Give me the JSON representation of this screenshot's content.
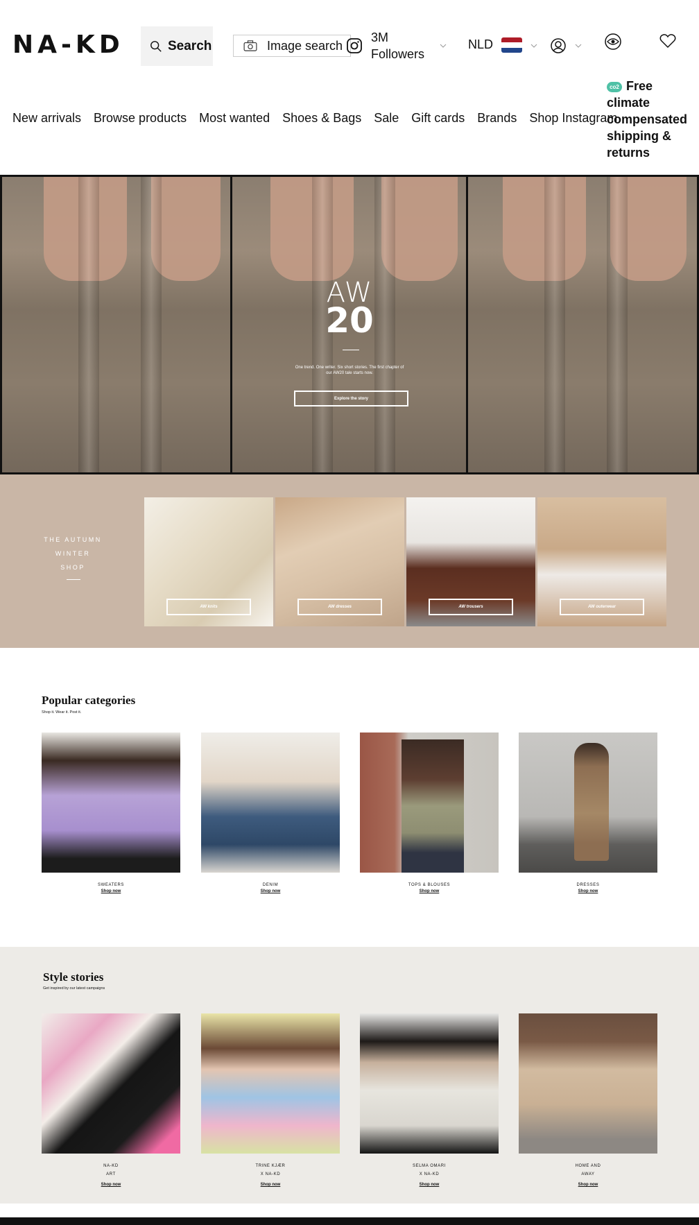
{
  "header": {
    "logo_text": "NA-KD",
    "search_label": "Search",
    "image_search_label": "Image search",
    "followers": "3M Followers",
    "country": "NLD",
    "flag_colors": [
      "#ae1c28",
      "#ffffff",
      "#21468b"
    ]
  },
  "nav": {
    "items": [
      "New arrivals",
      "Browse products",
      "Most wanted",
      "Shoes & Bags",
      "Sale",
      "Gift cards",
      "Brands",
      "Shop Instagram"
    ],
    "promo": "Free climate compensated shipping & returns",
    "promo_badge": "co2"
  },
  "hero": {
    "title": "AW",
    "year": "20",
    "description": "One trend. One writer. Six short stories. The first chapter of our AW20 tale starts now.",
    "button_label": "Explore the story"
  },
  "autumn": {
    "title": "THE AUTUMN WINTER SHOP",
    "tiles": [
      {
        "label": "AW knits"
      },
      {
        "label": "AW dresses"
      },
      {
        "label": "AW trousers"
      },
      {
        "label": "AW outerwear"
      }
    ]
  },
  "popular": {
    "title": "Popular categories",
    "subtitle": "Shop it. Wear it. Post it.",
    "cards": [
      {
        "name": "SWEATERS",
        "link": "Shop now"
      },
      {
        "name": "DENIM",
        "link": "Shop now"
      },
      {
        "name": "TOPS & BLOUSES",
        "link": "Shop now"
      },
      {
        "name": "DRESSES",
        "link": "Shop now"
      }
    ]
  },
  "stories": {
    "title": "Style stories",
    "subtitle": "Get inspired by our latest campaigns",
    "cards": [
      {
        "line1": "NA-KD",
        "line2": "ART",
        "link": "Shop now"
      },
      {
        "line1": "TRINE KJÆR",
        "line2": "X NA-KD",
        "link": "Shop now"
      },
      {
        "line1": "SELMA OMARI",
        "line2": "X NA-KD",
        "link": "Shop now"
      },
      {
        "line1": "HOME AND",
        "line2": "AWAY",
        "link": "Shop now"
      }
    ]
  },
  "colors": {
    "autumn_bg": "#c9b6a6",
    "stories_bg": "#edebe7",
    "co2_badge": "#4fc1a6"
  }
}
